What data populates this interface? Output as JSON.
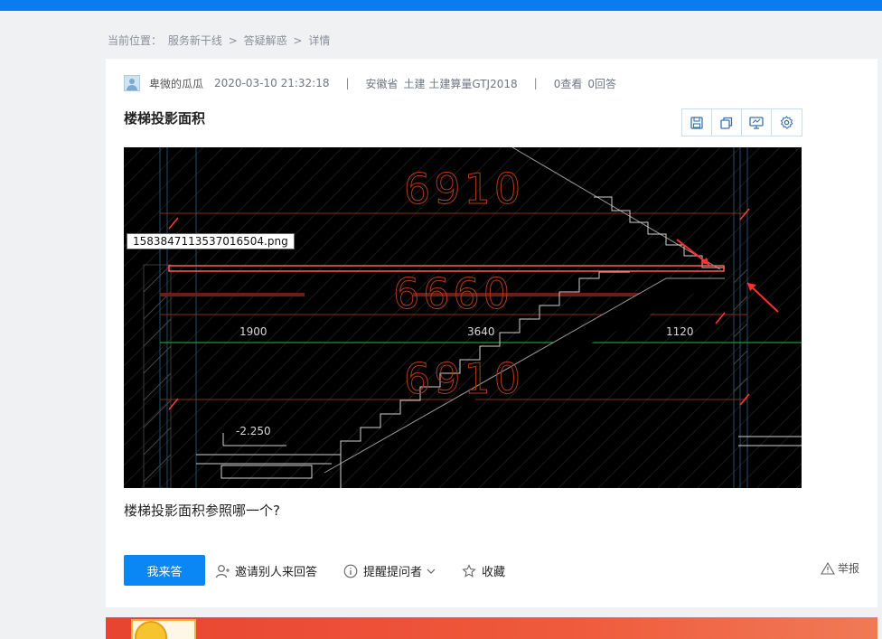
{
  "breadcrumb": {
    "label": "当前位置：",
    "items": [
      "服务新干线",
      "答疑解惑",
      "详情"
    ],
    "separator": ">"
  },
  "post": {
    "author": "卑微的瓜瓜",
    "datetime": "2020-03-10 21:32:18",
    "region": "安徽省",
    "category": "土建 土建算量GTJ2018",
    "views": "0查看",
    "answers": "0回答",
    "title": "楼梯投影面积",
    "image_filename": "1583847113537016504.png",
    "question": "楼梯投影面积参照哪一个?"
  },
  "toolbar": {
    "icons": [
      "save-icon",
      "copy-icon",
      "screen-icon",
      "settings-icon"
    ]
  },
  "cad": {
    "dim_texts": [
      "6910",
      "6660",
      "6910"
    ],
    "dim_labels": [
      "1900",
      "3640",
      "1120"
    ],
    "elevation": "-2.250"
  },
  "actions": {
    "answer_label": "我来答",
    "invite_label": "邀请别人来回答",
    "remind_label": "提醒提问者",
    "favorite_label": "收藏",
    "report_label": "举报"
  },
  "colors": {
    "brand": "#0a86f5",
    "topbar": "#0a7cf0",
    "banner": "#e8442f"
  }
}
